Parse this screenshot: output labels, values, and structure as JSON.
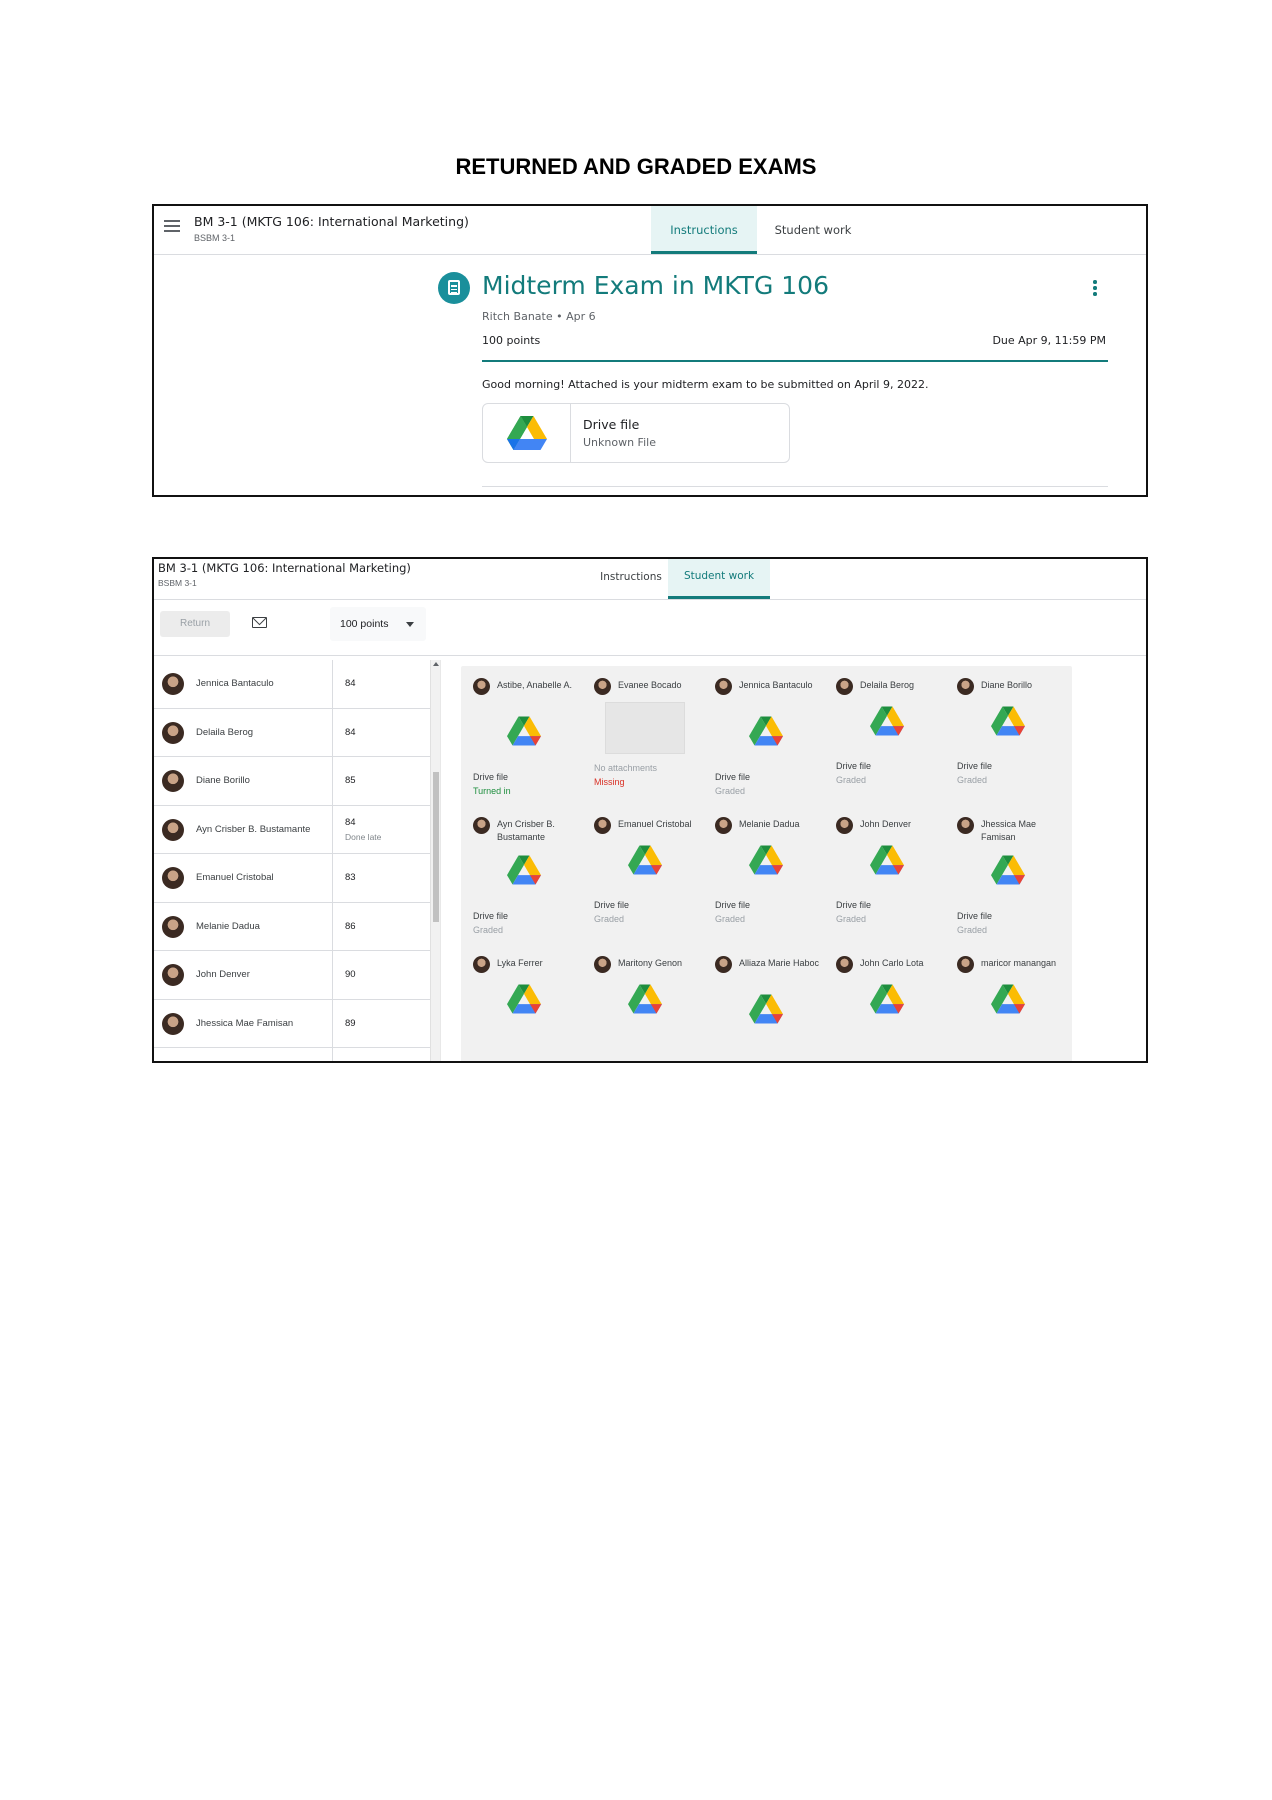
{
  "document": {
    "title": "RETURNED AND GRADED EXAMS"
  },
  "screenshot1": {
    "class_title": "BM 3-1 (MKTG 106: International Marketing)",
    "class_section": "BSBM 3-1",
    "tabs": [
      {
        "label": "Instructions",
        "active": true
      },
      {
        "label": "Student work",
        "active": false
      }
    ],
    "assignment": {
      "title": "Midterm Exam in MKTG 106",
      "author_date": "Ritch Banate • Apr 6",
      "points": "100 points",
      "due": "Due Apr 9, 11:59 PM",
      "body": "Good morning! Attached is your midterm exam to be submitted on April 9, 2022.",
      "attachment": {
        "name": "Drive file",
        "type": "Unknown File",
        "icon": "google-drive-icon"
      }
    },
    "colors": {
      "accent": "#137b7b",
      "icon_bg": "#1a8f9b"
    }
  },
  "screenshot2": {
    "class_title": "BM 3-1 (MKTG 106: International Marketing)",
    "class_section": "BSBM 3-1",
    "tabs": [
      {
        "label": "Instructions",
        "active": false
      },
      {
        "label": "Student work",
        "active": true
      }
    ],
    "toolbar": {
      "return_label": "Return",
      "mail_icon": "mail-icon",
      "points_select": "100 points"
    },
    "students": [
      {
        "name": "Jennica Bantaculo",
        "score": "84"
      },
      {
        "name": "Delaila Berog",
        "score": "84"
      },
      {
        "name": "Diane Borillo",
        "score": "85"
      },
      {
        "name": "Ayn Crisber B. Bustamante",
        "score": "84",
        "note": "Done late"
      },
      {
        "name": "Emanuel Cristobal",
        "score": "83"
      },
      {
        "name": "Melanie Dadua",
        "score": "86"
      },
      {
        "name": "John Denver",
        "score": "90"
      },
      {
        "name": "Jhessica Mae Famisan",
        "score": "89"
      }
    ],
    "cards": [
      {
        "name": "Astibe, Anabelle A.",
        "file": "Drive file",
        "status": "Turned in",
        "status_kind": "turned"
      },
      {
        "name": "Evanee Bocado",
        "file": "No attachments",
        "status": "Missing",
        "status_kind": "missing"
      },
      {
        "name": "Jennica Bantaculo",
        "file": "Drive file",
        "status": "Graded",
        "status_kind": "graded"
      },
      {
        "name": "Delaila Berog",
        "file": "Drive file",
        "status": "Graded",
        "status_kind": "graded"
      },
      {
        "name": "Diane Borillo",
        "file": "Drive file",
        "status": "Graded",
        "status_kind": "graded"
      },
      {
        "name": "Ayn Crisber B. Bustamante",
        "file": "Drive file",
        "status": "Graded",
        "status_kind": "graded"
      },
      {
        "name": "Emanuel Cristobal",
        "file": "Drive file",
        "status": "Graded",
        "status_kind": "graded"
      },
      {
        "name": "Melanie Dadua",
        "file": "Drive file",
        "status": "Graded",
        "status_kind": "graded"
      },
      {
        "name": "John Denver",
        "file": "Drive file",
        "status": "Graded",
        "status_kind": "graded"
      },
      {
        "name": "Jhessica Mae Famisan",
        "file": "Drive file",
        "status": "Graded",
        "status_kind": "graded"
      },
      {
        "name": "Lyka Ferrer"
      },
      {
        "name": "Maritony Genon"
      },
      {
        "name": "Alliaza Marie Haboc"
      },
      {
        "name": "John Carlo Lota"
      },
      {
        "name": "maricor manangan"
      }
    ],
    "colors": {
      "accent": "#137b7b",
      "graded": "#9aa0a6",
      "turned_in": "#1e8e3e",
      "missing": "#d93025"
    }
  }
}
